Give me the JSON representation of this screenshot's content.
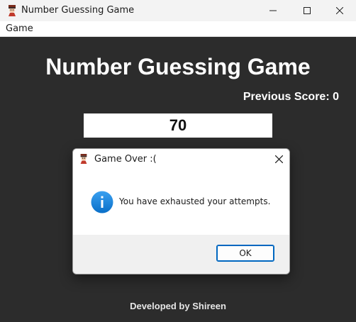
{
  "window": {
    "title": "Number Guessing Game",
    "icon": "app-icon"
  },
  "menubar": {
    "items": [
      {
        "label": "Game"
      }
    ]
  },
  "main": {
    "title": "Number Guessing Game",
    "previous_score": "Previous Score: 0",
    "guess_value": "70",
    "credit": "Developed by Shireen",
    "background": "#2c2c2c"
  },
  "dialog": {
    "title": "Game Over :(",
    "message": "You have exhausted your attempts.",
    "ok_label": "OK",
    "icon": "info-icon",
    "accent": "#0067c0"
  }
}
